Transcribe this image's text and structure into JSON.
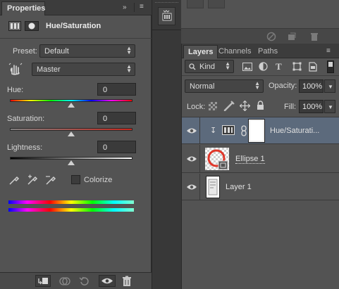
{
  "properties": {
    "tab_label": "Properties",
    "header_buttons": [
      "»",
      "≡"
    ],
    "adjustment_title": "Hue/Saturation",
    "preset_label": "Preset:",
    "preset_value": "Default",
    "channel_value": "Master",
    "hue_label": "Hue:",
    "hue_value": "0",
    "saturation_label": "Saturation:",
    "saturation_value": "0",
    "lightness_label": "Lightness:",
    "lightness_value": "0",
    "colorize_label": "Colorize",
    "colorize_checked": false,
    "sliders": {
      "hue": 0.5,
      "saturation": 0.5,
      "lightness": 0.5
    },
    "footer_icons": [
      "clip-to-layer-icon",
      "view-previous-icon",
      "reset-icon",
      "visibility-icon",
      "trash-icon"
    ]
  },
  "layers": {
    "tabs": [
      {
        "label": "Layers",
        "active": true
      },
      {
        "label": "Channels",
        "active": false
      },
      {
        "label": "Paths",
        "active": false
      }
    ],
    "filter_kind": "Kind",
    "blend_mode": "Normal",
    "opacity_label": "Opacity:",
    "opacity_value": "100%",
    "lock_label": "Lock:",
    "fill_label": "Fill:",
    "fill_value": "100%",
    "items": [
      {
        "name": "Hue/Saturati...",
        "type": "adjustment",
        "selected": true,
        "visible": true
      },
      {
        "name": "Ellipse 1",
        "type": "shape",
        "selected": false,
        "visible": true
      },
      {
        "name": "Layer 1",
        "type": "pixel",
        "selected": false,
        "visible": true
      }
    ]
  },
  "colors": {
    "panel_bg": "#535353",
    "selected_row": "#5c6a7c",
    "ellipse_red": "#e0372a"
  }
}
